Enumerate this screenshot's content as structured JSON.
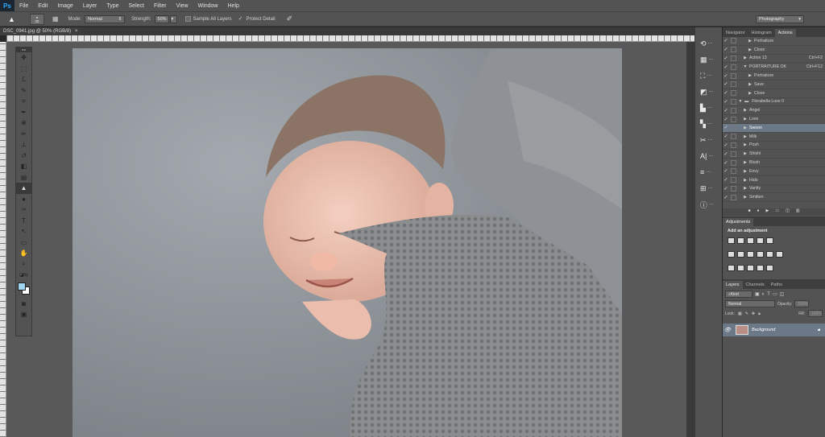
{
  "app": {
    "logo": "Ps"
  },
  "menu": [
    "File",
    "Edit",
    "Image",
    "Layer",
    "Type",
    "Select",
    "Filter",
    "View",
    "Window",
    "Help"
  ],
  "options": {
    "size_value": "30",
    "mode_label": "Mode:",
    "mode_value": "Normal",
    "strength_label": "Strength:",
    "strength_value": "50%",
    "sample_all_layers": "Sample All Layers",
    "protect_detail": "Protect Detail",
    "workspace": "Photography"
  },
  "document": {
    "tab_title": "DSC_0941.jpg @ 50% (RGB/8)"
  },
  "panels": {
    "top_tabs": [
      "Navigator",
      "Histogram",
      "Actions"
    ],
    "actions": [
      {
        "label": "Portraiture",
        "indent": 2,
        "checked": true,
        "expanded": false
      },
      {
        "label": "Close",
        "indent": 2,
        "checked": true,
        "expanded": false
      },
      {
        "label": "Action 13",
        "shortcut": "Ctrl+F2",
        "indent": 1,
        "checked": true,
        "expanded": false
      },
      {
        "label": "PORTRAITURE OK",
        "shortcut": "Ctrl+F12",
        "indent": 1,
        "checked": true,
        "expanded": true
      },
      {
        "label": "Portraiture",
        "indent": 2,
        "checked": true,
        "expanded": false
      },
      {
        "label": "Save",
        "indent": 2,
        "checked": true,
        "expanded": false
      },
      {
        "label": "Close",
        "indent": 2,
        "checked": true,
        "expanded": false
      },
      {
        "label": "Florabella Luxe II",
        "indent": 0,
        "checked": true,
        "expanded": true,
        "folder": true
      },
      {
        "label": "Angel",
        "indent": 1,
        "checked": true
      },
      {
        "label": "Love",
        "indent": 1,
        "checked": true
      },
      {
        "label": "Swoon",
        "indent": 1,
        "checked": true,
        "selected": true
      },
      {
        "label": "Milk",
        "indent": 1,
        "checked": true
      },
      {
        "label": "Posh",
        "indent": 1,
        "checked": true
      },
      {
        "label": "Shishi",
        "indent": 1,
        "checked": true
      },
      {
        "label": "Blush",
        "indent": 1,
        "checked": true
      },
      {
        "label": "Envy",
        "indent": 1,
        "checked": true
      },
      {
        "label": "Halo",
        "indent": 1,
        "checked": true
      },
      {
        "label": "Vanity",
        "indent": 1,
        "checked": true
      },
      {
        "label": "Smitten",
        "indent": 1,
        "checked": true
      }
    ],
    "adjustments": {
      "tab": "Adjustments",
      "title": "Add an adjustment"
    },
    "layers": {
      "tabs": [
        "Layers",
        "Channels",
        "Paths"
      ],
      "kind": "Kind",
      "blend": "Normal",
      "opacity_label": "Opacity:",
      "opacity_value": "100%",
      "lock_label": "Lock:",
      "fill_label": "Fill:",
      "fill_value": "100%",
      "background_layer": "Background"
    }
  }
}
